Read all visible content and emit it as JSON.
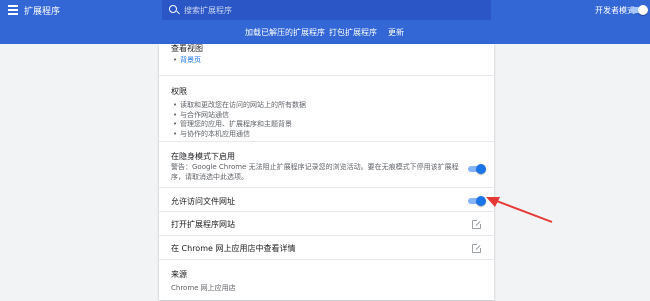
{
  "header": {
    "title": "扩展程序",
    "search_placeholder": "搜索扩展程序",
    "devmode_label": "开发者模式",
    "devmode_on": true
  },
  "subbar": {
    "load_unpacked": "加载已解压的扩展程序",
    "pack": "打包扩展程序",
    "update": "更新"
  },
  "details": {
    "inspect_views": {
      "title": "查看视图",
      "link": "背景页"
    },
    "permissions": {
      "title": "权限",
      "items": [
        "读取和更改您在访问的网站上的所有数据",
        "与合作网站通信",
        "管理您的应用、扩展程序和主题背景",
        "与协作的本机应用通信"
      ]
    },
    "incognito": {
      "title": "在隐身模式下启用",
      "warning": "警告：Google Chrome 无法阻止扩展程序记录您的浏览活动。要在无痕模式下停用该扩展程序，请取消选中此选项。",
      "enabled": true
    },
    "file_urls": {
      "title": "允许访问文件网址",
      "enabled": true
    },
    "open_site": {
      "title": "打开扩展程序网站"
    },
    "view_store": {
      "title": "在 Chrome 网上应用店中查看详情"
    },
    "source": {
      "title": "来源",
      "value": "Chrome 网上应用店"
    }
  },
  "colors": {
    "header_blue": "#3367d6",
    "accent_blue": "#1a73e8",
    "arrow_red": "#e53935"
  }
}
